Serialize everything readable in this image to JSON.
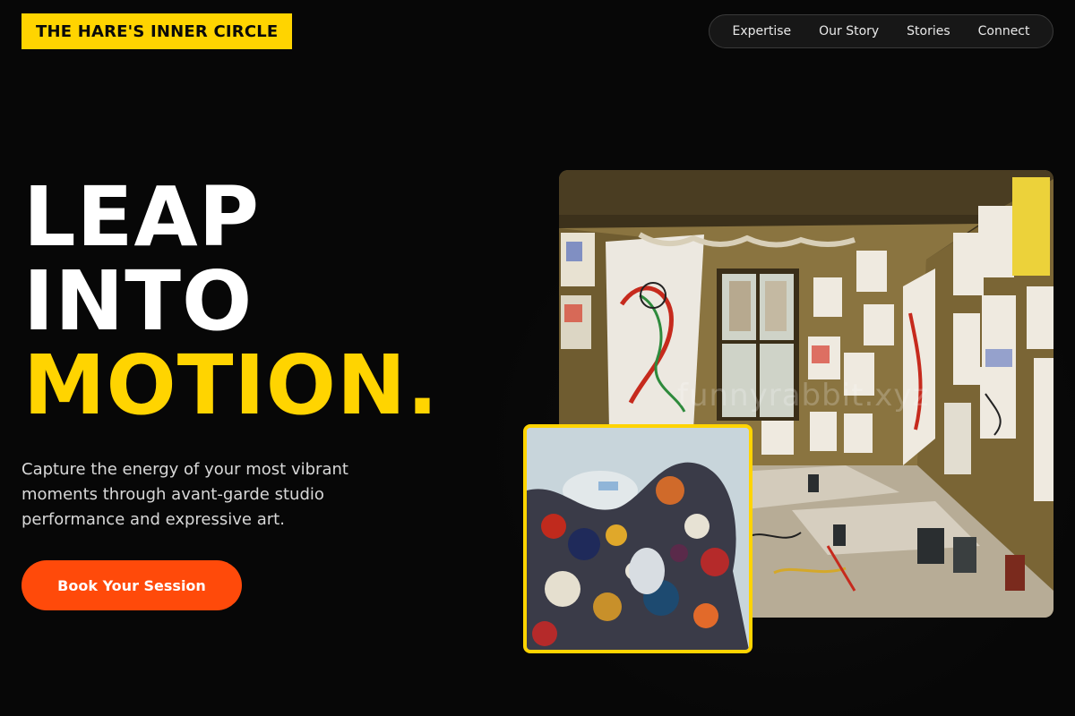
{
  "brand": {
    "name": "THE HARE'S INNER CIRCLE"
  },
  "nav": {
    "items": [
      {
        "label": "Expertise"
      },
      {
        "label": "Our Story"
      },
      {
        "label": "Stories"
      },
      {
        "label": "Connect"
      }
    ]
  },
  "hero": {
    "headline_line1": "LEAP",
    "headline_line2": "INTO",
    "headline_line3": "MOTION.",
    "subtext": "Capture the energy of your most vibrant moments through avant-garde studio performance and expressive art.",
    "cta_label": "Book Your Session"
  },
  "media": {
    "studio_image_icon": "art-studio-photo",
    "palette_image_icon": "paint-palette-photo",
    "watermark": "funnyrabbit.xyz"
  },
  "colors": {
    "background": "#070707",
    "accent_yellow": "#ffd400",
    "cta_orange": "#ff4a0a"
  }
}
